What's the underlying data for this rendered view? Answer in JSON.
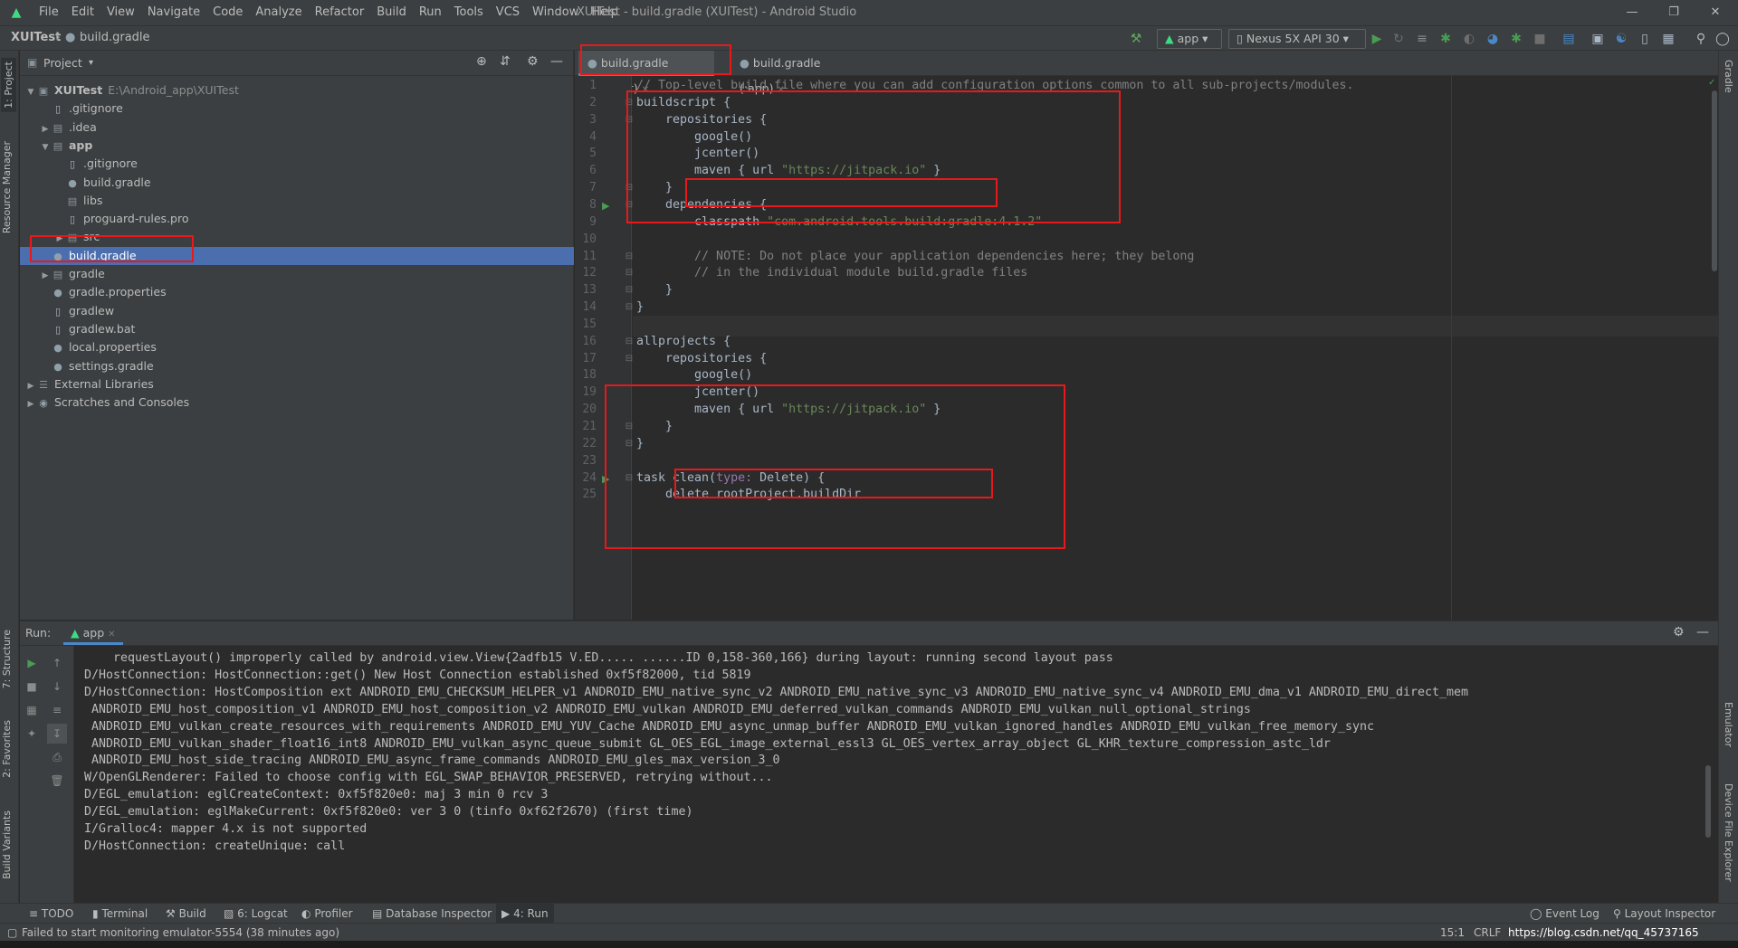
{
  "menubar": {
    "items": [
      "File",
      "Edit",
      "View",
      "Navigate",
      "Code",
      "Analyze",
      "Refactor",
      "Build",
      "Run",
      "Tools",
      "VCS",
      "Window",
      "Help"
    ],
    "window_title": "XUITest - build.gradle (XUITest) - Android Studio"
  },
  "navbar": {
    "project": "XUITest",
    "file": "build.gradle",
    "run_config": "app",
    "device": "Nexus 5X API 30"
  },
  "left_strip": {
    "project": "1: Project",
    "resource_manager": "Resource Manager",
    "structure": "7: Structure",
    "favorites": "2: Favorites",
    "build_variants": "Build Variants"
  },
  "right_strip": {
    "gradle": "Gradle",
    "emulator": "Emulator",
    "device_file_explorer": "Device File Explorer"
  },
  "project_panel": {
    "view_selector": "Project",
    "tree": [
      {
        "label": "XUITest",
        "path": "E:\\Android_app\\XUITest",
        "depth": 0,
        "kind": "module",
        "expanded": true
      },
      {
        "label": ".gitignore",
        "depth": 1,
        "kind": "file"
      },
      {
        "label": ".idea",
        "depth": 1,
        "kind": "folder",
        "expanded": false
      },
      {
        "label": "app",
        "depth": 1,
        "kind": "folder",
        "expanded": true
      },
      {
        "label": ".gitignore",
        "depth": 2,
        "kind": "file"
      },
      {
        "label": "build.gradle",
        "depth": 2,
        "kind": "gradle"
      },
      {
        "label": "libs",
        "depth": 2,
        "kind": "folder"
      },
      {
        "label": "proguard-rules.pro",
        "depth": 2,
        "kind": "file"
      },
      {
        "label": "src",
        "depth": 2,
        "kind": "folder",
        "expanded": false
      },
      {
        "label": "build.gradle",
        "depth": 1,
        "kind": "gradle",
        "selected": true
      },
      {
        "label": "gradle",
        "depth": 1,
        "kind": "folder",
        "expanded": false
      },
      {
        "label": "gradle.properties",
        "depth": 1,
        "kind": "gradle"
      },
      {
        "label": "gradlew",
        "depth": 1,
        "kind": "file"
      },
      {
        "label": "gradlew.bat",
        "depth": 1,
        "kind": "file"
      },
      {
        "label": "local.properties",
        "depth": 1,
        "kind": "gradle"
      },
      {
        "label": "settings.gradle",
        "depth": 1,
        "kind": "gradle"
      },
      {
        "label": "External Libraries",
        "depth": 0,
        "kind": "libs",
        "expanded": false
      },
      {
        "label": "Scratches and Consoles",
        "depth": 0,
        "kind": "scratch",
        "expanded": false
      }
    ]
  },
  "editor": {
    "tabs": [
      {
        "label": "build.gradle (XUITest)",
        "active": true
      },
      {
        "label": "build.gradle (:app)",
        "active": false
      }
    ],
    "lines": [
      {
        "n": "1",
        "text": "// Top-level build file where you can add configuration options common to all sub-projects/modules."
      },
      {
        "n": "2",
        "text": "buildscript {"
      },
      {
        "n": "3",
        "text": "    repositories {"
      },
      {
        "n": "4",
        "text": "        google()"
      },
      {
        "n": "5",
        "text": "        jcenter()"
      },
      {
        "n": "6",
        "text": "        maven { url \"https://jitpack.io\" }"
      },
      {
        "n": "7",
        "text": "    }"
      },
      {
        "n": "8",
        "text": "    dependencies {"
      },
      {
        "n": "9",
        "text": "        classpath \"com.android.tools.build:gradle:4.1.2\""
      },
      {
        "n": "10",
        "text": ""
      },
      {
        "n": "11",
        "text": "        // NOTE: Do not place your application dependencies here; they belong"
      },
      {
        "n": "12",
        "text": "        // in the individual module build.gradle files"
      },
      {
        "n": "13",
        "text": "    }"
      },
      {
        "n": "14",
        "text": "}"
      },
      {
        "n": "15",
        "text": ""
      },
      {
        "n": "16",
        "text": "allprojects {"
      },
      {
        "n": "17",
        "text": "    repositories {"
      },
      {
        "n": "18",
        "text": "        google()"
      },
      {
        "n": "19",
        "text": "        jcenter()"
      },
      {
        "n": "20",
        "text": "        maven { url \"https://jitpack.io\" }"
      },
      {
        "n": "21",
        "text": "    }"
      },
      {
        "n": "22",
        "text": "}"
      },
      {
        "n": "23",
        "text": ""
      },
      {
        "n": "24",
        "text": "task clean(type: Delete) {"
      },
      {
        "n": "25",
        "text": "    delete rootProject.buildDir"
      }
    ]
  },
  "run_panel": {
    "label": "Run:",
    "tab": "app",
    "log": [
      "    requestLayout() improperly called by android.view.View{2adfb15 V.ED..... ......ID 0,158-360,166} during layout: running second layout pass",
      "D/HostConnection: HostConnection::get() New Host Connection established 0xf5f82000, tid 5819",
      "D/HostConnection: HostComposition ext ANDROID_EMU_CHECKSUM_HELPER_v1 ANDROID_EMU_native_sync_v2 ANDROID_EMU_native_sync_v3 ANDROID_EMU_native_sync_v4 ANDROID_EMU_dma_v1 ANDROID_EMU_direct_mem",
      " ANDROID_EMU_host_composition_v1 ANDROID_EMU_host_composition_v2 ANDROID_EMU_vulkan ANDROID_EMU_deferred_vulkan_commands ANDROID_EMU_vulkan_null_optional_strings",
      " ANDROID_EMU_vulkan_create_resources_with_requirements ANDROID_EMU_YUV_Cache ANDROID_EMU_async_unmap_buffer ANDROID_EMU_vulkan_ignored_handles ANDROID_EMU_vulkan_free_memory_sync",
      " ANDROID_EMU_vulkan_shader_float16_int8 ANDROID_EMU_vulkan_async_queue_submit GL_OES_EGL_image_external_essl3 GL_OES_vertex_array_object GL_KHR_texture_compression_astc_ldr",
      " ANDROID_EMU_host_side_tracing ANDROID_EMU_async_frame_commands ANDROID_EMU_gles_max_version_3_0",
      "W/OpenGLRenderer: Failed to choose config with EGL_SWAP_BEHAVIOR_PRESERVED, retrying without...",
      "D/EGL_emulation: eglCreateContext: 0xf5f820e0: maj 3 min 0 rcv 3",
      "D/EGL_emulation: eglMakeCurrent: 0xf5f820e0: ver 3 0 (tinfo 0xf62f2670) (first time)",
      "I/Gralloc4: mapper 4.x is not supported",
      "D/HostConnection: createUnique: call"
    ]
  },
  "bottom_tools": {
    "todo": "TODO",
    "terminal": "Terminal",
    "build": "Build",
    "logcat": "6: Logcat",
    "profiler": "Profiler",
    "database_inspector": "Database Inspector",
    "run": "4: Run",
    "event_log": "Event Log",
    "layout_inspector": "Layout Inspector"
  },
  "status": {
    "message": "Failed to start monitoring emulator-5554 (38 minutes ago)",
    "position": "15:1",
    "line_sep": "CRLF",
    "watermark": "https://blog.csdn.net/qq_45737165"
  },
  "colors": {
    "highlight_box": "#e8191a",
    "selection": "#4b6eaf",
    "string": "#6a8759",
    "comment": "#808080"
  }
}
